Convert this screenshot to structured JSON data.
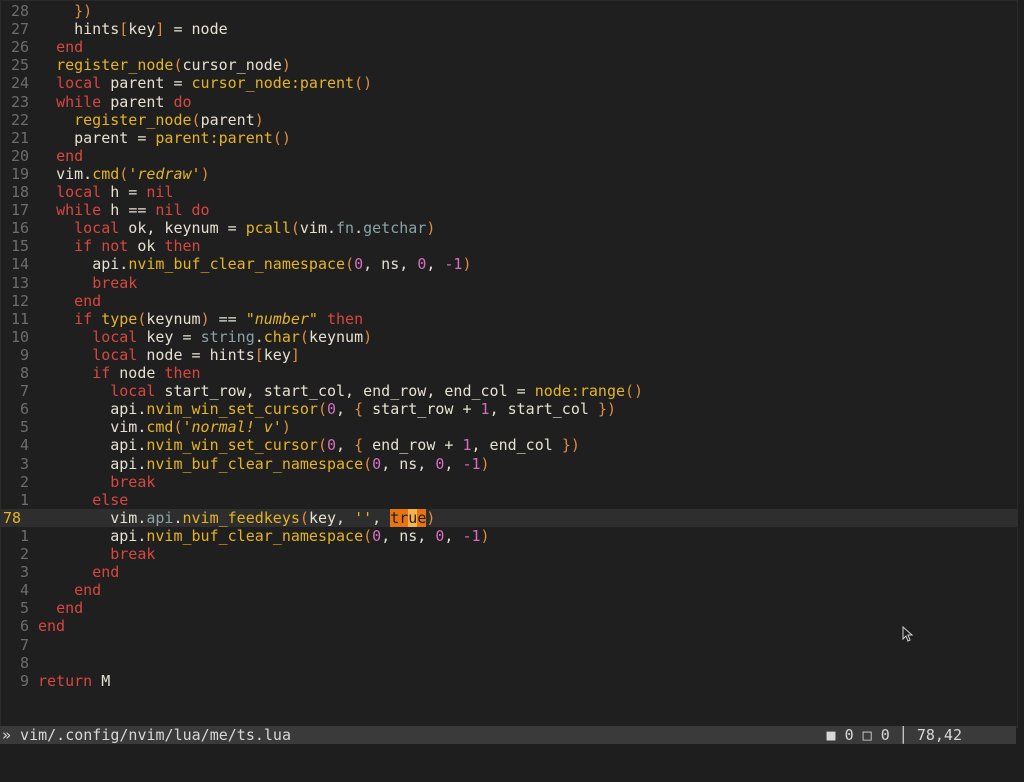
{
  "editor": {
    "lines": [
      {
        "ln": "28",
        "parts": [
          [
            "",
            "    "
          ],
          [
            "br",
            "})"
          ]
        ]
      },
      {
        "ln": "27",
        "parts": [
          [
            "",
            "    "
          ],
          [
            "id",
            "hints"
          ],
          [
            "br",
            "["
          ],
          [
            "id",
            "key"
          ],
          [
            "br",
            "]"
          ],
          [
            "op",
            " = "
          ],
          [
            "id",
            "node"
          ]
        ]
      },
      {
        "ln": "26",
        "parts": [
          [
            "",
            "  "
          ],
          [
            "kw",
            "end"
          ]
        ]
      },
      {
        "ln": "25",
        "parts": [
          [
            "",
            "  "
          ],
          [
            "fn",
            "register_node"
          ],
          [
            "br",
            "("
          ],
          [
            "id",
            "cursor_node"
          ],
          [
            "br",
            ")"
          ]
        ]
      },
      {
        "ln": "24",
        "parts": [
          [
            "",
            "  "
          ],
          [
            "kw",
            "local"
          ],
          [
            "id",
            " parent"
          ],
          [
            "op",
            " = "
          ],
          [
            "fn",
            "cursor_node:parent"
          ],
          [
            "br",
            "()"
          ]
        ]
      },
      {
        "ln": "23",
        "parts": [
          [
            "",
            "  "
          ],
          [
            "kw",
            "while"
          ],
          [
            "id",
            " parent "
          ],
          [
            "kw",
            "do"
          ]
        ]
      },
      {
        "ln": "22",
        "parts": [
          [
            "",
            "    "
          ],
          [
            "fn",
            "register_node"
          ],
          [
            "br",
            "("
          ],
          [
            "id",
            "parent"
          ],
          [
            "br",
            ")"
          ]
        ]
      },
      {
        "ln": "21",
        "parts": [
          [
            "",
            "    "
          ],
          [
            "id",
            "parent"
          ],
          [
            "op",
            " = "
          ],
          [
            "fn",
            "parent:parent"
          ],
          [
            "br",
            "()"
          ]
        ]
      },
      {
        "ln": "20",
        "parts": [
          [
            "",
            "  "
          ],
          [
            "kw",
            "end"
          ]
        ]
      },
      {
        "ln": "19",
        "parts": [
          [
            "",
            "  "
          ],
          [
            "id",
            "vim"
          ],
          [
            "op",
            "."
          ],
          [
            "fn",
            "cmd"
          ],
          [
            "br",
            "("
          ],
          [
            "str",
            "'redraw'"
          ],
          [
            "br",
            ")"
          ]
        ]
      },
      {
        "ln": "18",
        "parts": [
          [
            "",
            "  "
          ],
          [
            "kw",
            "local"
          ],
          [
            "id",
            " h"
          ],
          [
            "op",
            " = "
          ],
          [
            "kw",
            "nil"
          ]
        ]
      },
      {
        "ln": "17",
        "parts": [
          [
            "",
            "  "
          ],
          [
            "kw",
            "while"
          ],
          [
            "id",
            " h "
          ],
          [
            "op",
            "=="
          ],
          [
            "kw",
            " nil "
          ],
          [
            "kw",
            "do"
          ]
        ]
      },
      {
        "ln": "16",
        "parts": [
          [
            "",
            "    "
          ],
          [
            "kw",
            "local"
          ],
          [
            "id",
            " ok, keynum"
          ],
          [
            "op",
            " = "
          ],
          [
            "fn",
            "pcall"
          ],
          [
            "br",
            "("
          ],
          [
            "id",
            "vim"
          ],
          [
            "op",
            "."
          ],
          [
            "dim",
            "fn"
          ],
          [
            "op",
            "."
          ],
          [
            "dim",
            "getchar"
          ],
          [
            "br",
            ")"
          ]
        ]
      },
      {
        "ln": "15",
        "parts": [
          [
            "",
            "    "
          ],
          [
            "kw",
            "if"
          ],
          [
            "kw",
            " not"
          ],
          [
            "id",
            " ok "
          ],
          [
            "kw",
            "then"
          ]
        ]
      },
      {
        "ln": "14",
        "parts": [
          [
            "",
            "      "
          ],
          [
            "id",
            "api"
          ],
          [
            "op",
            "."
          ],
          [
            "fn",
            "nvim_buf_clear_namespace"
          ],
          [
            "br",
            "("
          ],
          [
            "num",
            "0"
          ],
          [
            "id",
            ", ns, "
          ],
          [
            "num",
            "0"
          ],
          [
            "id",
            ", "
          ],
          [
            "num",
            "-1"
          ],
          [
            "br",
            ")"
          ]
        ]
      },
      {
        "ln": "13",
        "parts": [
          [
            "",
            "      "
          ],
          [
            "kw",
            "break"
          ]
        ]
      },
      {
        "ln": "12",
        "parts": [
          [
            "",
            "    "
          ],
          [
            "kw",
            "end"
          ]
        ]
      },
      {
        "ln": "11",
        "parts": [
          [
            "",
            "    "
          ],
          [
            "kw",
            "if"
          ],
          [
            "fn",
            " type"
          ],
          [
            "br",
            "("
          ],
          [
            "id",
            "keynum"
          ],
          [
            "br",
            ")"
          ],
          [
            "op",
            " == "
          ],
          [
            "str",
            "\"number\""
          ],
          [
            "kw",
            " then"
          ]
        ]
      },
      {
        "ln": "10",
        "parts": [
          [
            "",
            "      "
          ],
          [
            "kw",
            "local"
          ],
          [
            "id",
            " key"
          ],
          [
            "op",
            " = "
          ],
          [
            "dim",
            "string"
          ],
          [
            "op",
            "."
          ],
          [
            "fn",
            "char"
          ],
          [
            "br",
            "("
          ],
          [
            "id",
            "keynum"
          ],
          [
            "br",
            ")"
          ]
        ]
      },
      {
        "ln": "9",
        "parts": [
          [
            "",
            "      "
          ],
          [
            "kw",
            "local"
          ],
          [
            "id",
            " node"
          ],
          [
            "op",
            " = "
          ],
          [
            "id",
            "hints"
          ],
          [
            "br",
            "["
          ],
          [
            "id",
            "key"
          ],
          [
            "br",
            "]"
          ]
        ]
      },
      {
        "ln": "8",
        "parts": [
          [
            "",
            "      "
          ],
          [
            "kw",
            "if"
          ],
          [
            "id",
            " node "
          ],
          [
            "kw",
            "then"
          ]
        ]
      },
      {
        "ln": "7",
        "parts": [
          [
            "",
            "        "
          ],
          [
            "kw",
            "local"
          ],
          [
            "id",
            " start_row, start_col, end_row, end_col"
          ],
          [
            "op",
            " = "
          ],
          [
            "fn",
            "node:range"
          ],
          [
            "br",
            "()"
          ]
        ]
      },
      {
        "ln": "6",
        "parts": [
          [
            "",
            "        "
          ],
          [
            "id",
            "api"
          ],
          [
            "op",
            "."
          ],
          [
            "fn",
            "nvim_win_set_cursor"
          ],
          [
            "br",
            "("
          ],
          [
            "num",
            "0"
          ],
          [
            "id",
            ", "
          ],
          [
            "br",
            "{"
          ],
          [
            "id",
            " start_row + "
          ],
          [
            "num",
            "1"
          ],
          [
            "id",
            ", start_col "
          ],
          [
            "br",
            "}"
          ],
          [
            "br",
            ")"
          ]
        ]
      },
      {
        "ln": "5",
        "parts": [
          [
            "",
            "        "
          ],
          [
            "id",
            "vim"
          ],
          [
            "op",
            "."
          ],
          [
            "fn",
            "cmd"
          ],
          [
            "br",
            "("
          ],
          [
            "str",
            "'normal! v'"
          ],
          [
            "br",
            ")"
          ]
        ]
      },
      {
        "ln": "4",
        "parts": [
          [
            "",
            "        "
          ],
          [
            "id",
            "api"
          ],
          [
            "op",
            "."
          ],
          [
            "fn",
            "nvim_win_set_cursor"
          ],
          [
            "br",
            "("
          ],
          [
            "num",
            "0"
          ],
          [
            "id",
            ", "
          ],
          [
            "br",
            "{"
          ],
          [
            "id",
            " end_row + "
          ],
          [
            "num",
            "1"
          ],
          [
            "id",
            ", end_col "
          ],
          [
            "br",
            "}"
          ],
          [
            "br",
            ")"
          ]
        ]
      },
      {
        "ln": "3",
        "parts": [
          [
            "",
            "        "
          ],
          [
            "id",
            "api"
          ],
          [
            "op",
            "."
          ],
          [
            "fn",
            "nvim_buf_clear_namespace"
          ],
          [
            "br",
            "("
          ],
          [
            "num",
            "0"
          ],
          [
            "id",
            ", ns, "
          ],
          [
            "num",
            "0"
          ],
          [
            "id",
            ", "
          ],
          [
            "num",
            "-1"
          ],
          [
            "br",
            ")"
          ]
        ]
      },
      {
        "ln": "2",
        "parts": [
          [
            "",
            "        "
          ],
          [
            "kw",
            "break"
          ]
        ]
      },
      {
        "ln": "1",
        "parts": [
          [
            "",
            "      "
          ],
          [
            "kw",
            "else"
          ]
        ]
      },
      {
        "ln": "78",
        "current": true,
        "parts": [
          [
            "",
            "        "
          ],
          [
            "id",
            "vim"
          ],
          [
            "op",
            "."
          ],
          [
            "dim",
            "api"
          ],
          [
            "op",
            "."
          ],
          [
            "fn",
            "nvim_feedkeys"
          ],
          [
            "br",
            "("
          ],
          [
            "id",
            "key, "
          ],
          [
            "str",
            "''"
          ],
          [
            "id",
            ", "
          ],
          [
            "hl",
            "tr"
          ],
          [
            "hlc",
            "u"
          ],
          [
            "hl",
            "e"
          ],
          [
            "br",
            ")"
          ]
        ]
      },
      {
        "ln": "1",
        "parts": [
          [
            "",
            "        "
          ],
          [
            "id",
            "api"
          ],
          [
            "op",
            "."
          ],
          [
            "fn",
            "nvim_buf_clear_namespace"
          ],
          [
            "br",
            "("
          ],
          [
            "num",
            "0"
          ],
          [
            "id",
            ", ns, "
          ],
          [
            "num",
            "0"
          ],
          [
            "id",
            ", "
          ],
          [
            "num",
            "-1"
          ],
          [
            "br",
            ")"
          ]
        ]
      },
      {
        "ln": "2",
        "parts": [
          [
            "",
            "        "
          ],
          [
            "kw",
            "break"
          ]
        ]
      },
      {
        "ln": "3",
        "parts": [
          [
            "",
            "      "
          ],
          [
            "kw",
            "end"
          ]
        ]
      },
      {
        "ln": "4",
        "parts": [
          [
            "",
            "    "
          ],
          [
            "kw",
            "end"
          ]
        ]
      },
      {
        "ln": "5",
        "parts": [
          [
            "",
            "  "
          ],
          [
            "kw",
            "end"
          ]
        ]
      },
      {
        "ln": "6",
        "parts": [
          [
            "",
            ""
          ],
          [
            "kw",
            "end"
          ]
        ]
      },
      {
        "ln": "7",
        "parts": []
      },
      {
        "ln": "8",
        "parts": []
      },
      {
        "ln": "9",
        "parts": [
          [
            "",
            ""
          ],
          [
            "kw",
            "return"
          ],
          [
            "id",
            " M"
          ]
        ]
      }
    ]
  },
  "statusbar": {
    "left": "» vim/.config/nvim/lua/me/ts.lua",
    "right": "■ 0 □ 0 │ 78,42"
  },
  "icons": {
    "mouse_cursor": "arrow-cursor-icon"
  }
}
